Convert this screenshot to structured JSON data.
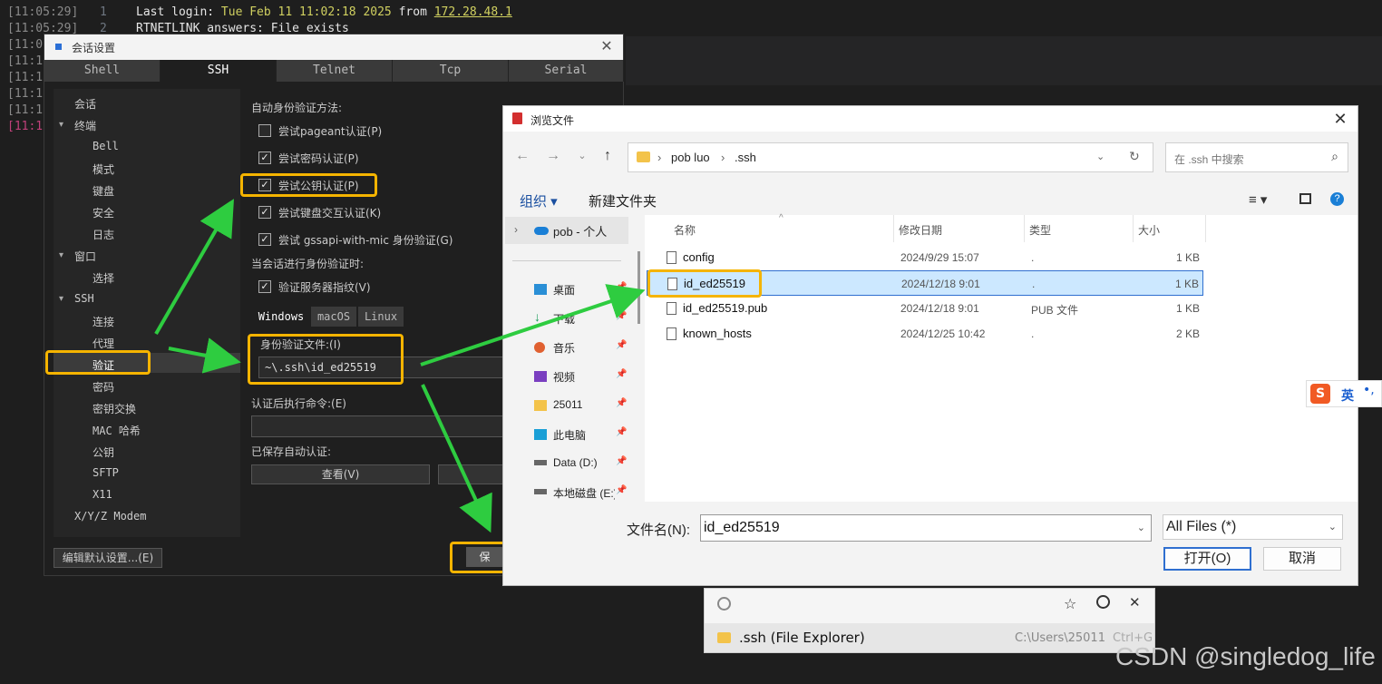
{
  "terminal": {
    "lines": [
      {
        "ts": "[11:05:29]",
        "num": "1",
        "text": "Last login: Tue Feb 11 11:02:18 2025 from 172.28.48.1"
      },
      {
        "ts": "[11:05:29]",
        "num": "2",
        "text": "RTNETLINK answers: File exists"
      }
    ],
    "hidden_ts": [
      "[11:0",
      "[11:1",
      "[11:1",
      "[11:1",
      "[11:1",
      "[11:1"
    ]
  },
  "session_dialog": {
    "title": "会话设置",
    "tabs": [
      "Shell",
      "SSH",
      "Telnet",
      "Tcp",
      "Serial"
    ],
    "active_tab": "SSH",
    "tree": [
      {
        "label": "会话",
        "level": 1
      },
      {
        "label": "终端",
        "level": 0
      },
      {
        "label": "Bell",
        "level": 2
      },
      {
        "label": "模式",
        "level": 2
      },
      {
        "label": "键盘",
        "level": 2
      },
      {
        "label": "安全",
        "level": 2
      },
      {
        "label": "日志",
        "level": 2
      },
      {
        "label": "窗口",
        "level": 0
      },
      {
        "label": "选择",
        "level": 2
      },
      {
        "label": "SSH",
        "level": 0
      },
      {
        "label": "连接",
        "level": 2
      },
      {
        "label": "代理",
        "level": 2
      },
      {
        "label": "验证",
        "level": 2
      },
      {
        "label": "密码",
        "level": 2
      },
      {
        "label": "密钥交换",
        "level": 2
      },
      {
        "label": "MAC 哈希",
        "level": 2
      },
      {
        "label": "公钥",
        "level": 2
      },
      {
        "label": "SFTP",
        "level": 2
      },
      {
        "label": "X11",
        "level": 2
      },
      {
        "label": "X/Y/Z Modem",
        "level": 1
      }
    ],
    "auth_heading": "自动身份验证方法:",
    "options": [
      {
        "label": "尝试pageant认证(P)",
        "checked": false
      },
      {
        "label": "尝试密码认证(P)",
        "checked": true
      },
      {
        "label": "尝试公钥认证(P)",
        "checked": true
      },
      {
        "label": "尝试键盘交互认证(K)",
        "checked": true
      },
      {
        "label": "尝试 gssapi-with-mic 身份验证(G)",
        "checked": true
      }
    ],
    "when_auth": "当会话进行身份验证时:",
    "verify_fp": {
      "label": "验证服务器指纹(V)",
      "checked": true
    },
    "os_tabs": [
      "Windows",
      "macOS",
      "Linux"
    ],
    "identity_label": "身份验证文件:(I)",
    "identity_value": "~\\.ssh\\id_ed25519",
    "post_cmd_label": "认证后执行命令:(E)",
    "saved_label": "已保存自动认证:",
    "view_button": "查看(V)",
    "edit_default_button": "编辑默认设置...(E)",
    "save_button": "保"
  },
  "file_dialog": {
    "title": "浏览文件",
    "breadcrumb": [
      "pob luo",
      ".ssh"
    ],
    "search_placeholder": "在 .ssh 中搜索",
    "organize": "组织",
    "new_folder": "新建文件夹",
    "nav": [
      {
        "label": "pob - 个人",
        "icon": "cloud-icon"
      },
      {
        "label": "桌面",
        "icon": "desktop-icon"
      },
      {
        "label": "下载",
        "icon": "download-icon"
      },
      {
        "label": "音乐",
        "icon": "music-icon"
      },
      {
        "label": "视频",
        "icon": "video-icon"
      },
      {
        "label": "25011",
        "icon": "folder-icon"
      },
      {
        "label": "此电脑",
        "icon": "computer-icon"
      },
      {
        "label": "Data (D:)",
        "icon": "drive-icon"
      },
      {
        "label": "本地磁盘 (E:)",
        "icon": "drive-icon"
      }
    ],
    "columns": [
      "名称",
      "修改日期",
      "类型",
      "大小"
    ],
    "files": [
      {
        "name": "config",
        "date": "2024/9/29 15:07",
        "type": ".",
        "size": "1 KB",
        "selected": false
      },
      {
        "name": "id_ed25519",
        "date": "2024/12/18 9:01",
        "type": ".",
        "size": "1 KB",
        "selected": true
      },
      {
        "name": "id_ed25519.pub",
        "date": "2024/12/18 9:01",
        "type": "PUB 文件",
        "size": "1 KB",
        "selected": false
      },
      {
        "name": "known_hosts",
        "date": "2024/12/25 10:42",
        "type": ".",
        "size": "2 KB",
        "selected": false
      }
    ],
    "filename_label": "文件名(N):",
    "filename_value": "id_ed25519",
    "filter": "All Files (*)",
    "open_button": "打开(O)",
    "cancel_button": "取消"
  },
  "launcher": {
    "result_label": ".ssh (File Explorer)",
    "result_path": "C:\\Users\\25011",
    "shortcut": "Ctrl+G"
  },
  "ime": {
    "label": "英"
  },
  "watermark": "CSDN @singledog_life",
  "colors": {
    "highlight": "#f5b400",
    "arrow": "#2ecc40",
    "selection": "#cce8ff",
    "accent": "#2f6fd0"
  }
}
